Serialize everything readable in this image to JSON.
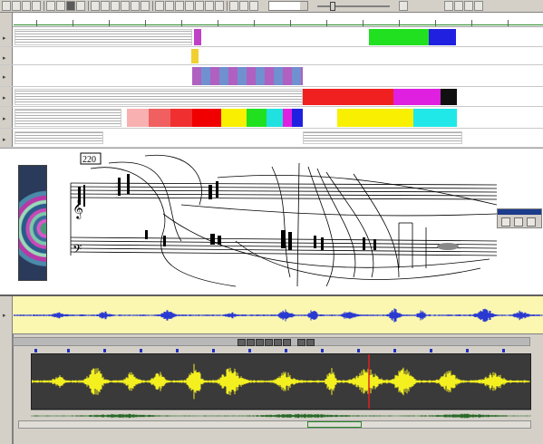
{
  "toolbar": {
    "zoom_value": "",
    "button_icons": [
      "new-file-icon",
      "open-icon",
      "save-icon",
      "cut-icon",
      "copy-icon",
      "paste-icon",
      "undo-icon",
      "redo-icon",
      "play-icon",
      "stop-icon",
      "record-icon",
      "loop-icon",
      "zoom-in-icon",
      "zoom-out-icon",
      "select-icon",
      "pencil-icon",
      "eraser-icon",
      "grid-icon",
      "snap-icon",
      "help-icon"
    ]
  },
  "score": {
    "measure_number": "220"
  },
  "sound_editor": {
    "time_readout": ""
  },
  "colors": {
    "overview_bg": "#fbf6b0",
    "wave_blue": "#2a3ad0",
    "wave_yellow": "#f4f020",
    "wave_bg": "#3a3a3a",
    "playhead": "#e02020"
  }
}
